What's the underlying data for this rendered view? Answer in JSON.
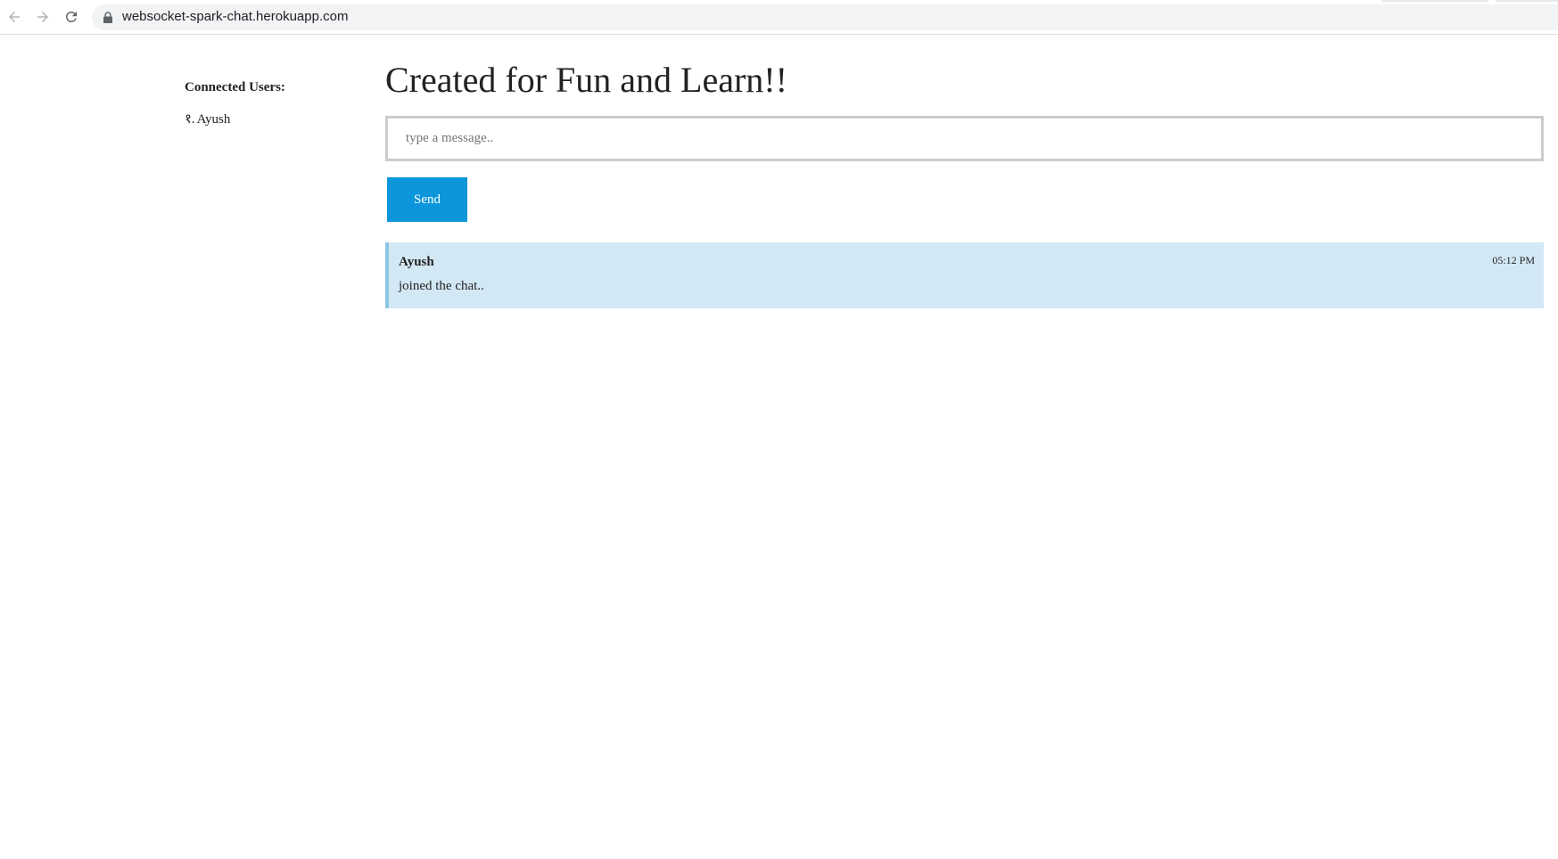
{
  "browser": {
    "url": "websocket-spark-chat.herokuapp.com",
    "icons": {
      "back": "arrow-left-icon",
      "forward": "arrow-right-icon",
      "reload": "reload-icon",
      "lock": "lock-icon"
    }
  },
  "sidebar": {
    "title": "Connected Users:",
    "users": [
      {
        "number": "१.",
        "name": "Ayush"
      }
    ]
  },
  "main": {
    "title": "Created for Fun and Learn!!",
    "input": {
      "placeholder": "type a message..",
      "value": ""
    },
    "send_label": "Send",
    "messages": [
      {
        "author": "Ayush",
        "text": "joined the chat..",
        "time": "05:12 PM"
      }
    ]
  },
  "colors": {
    "accent": "#0b96db",
    "message_bg": "#d3e8f5",
    "message_border": "#8cc5e6",
    "input_border": "#cccccc"
  }
}
